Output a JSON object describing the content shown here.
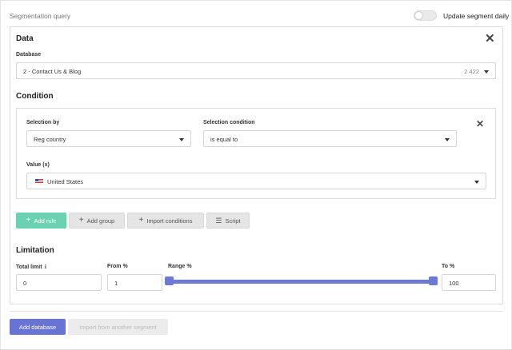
{
  "header": {
    "title": "Segmentation query",
    "toggle_label": "Update segment daily",
    "toggle_on": false
  },
  "data_section": {
    "title": "Data",
    "close_icon": "close-icon",
    "database_label": "Database",
    "database_value": "2 - Contact Us & Blog",
    "database_count": "2 422"
  },
  "condition": {
    "title": "Condition",
    "selection_by_label": "Selection by",
    "selection_by_value": "Reg country",
    "selection_condition_label": "Selection condition",
    "selection_condition_value": "is equal to",
    "value_label": "Value (x)",
    "value_value": "United States",
    "value_flag": "us-flag-icon"
  },
  "actions": {
    "add_rule": "Add rule",
    "add_group": "Add group",
    "import_conditions": "Import conditions",
    "script": "Script"
  },
  "limitation": {
    "title": "Limitation",
    "total_limit_label": "Total limit",
    "total_limit_value": "0",
    "from_label": "From %",
    "from_value": "1",
    "range_label": "Range %",
    "to_label": "To %",
    "to_value": "100",
    "range_from_percent": 1,
    "range_to_percent": 100
  },
  "footer": {
    "add_database": "Add database",
    "import_segment": "Import from another segment"
  },
  "colors": {
    "primary": "#6774d3",
    "success": "#6cd1b1",
    "slider": "#6b7bd1"
  }
}
